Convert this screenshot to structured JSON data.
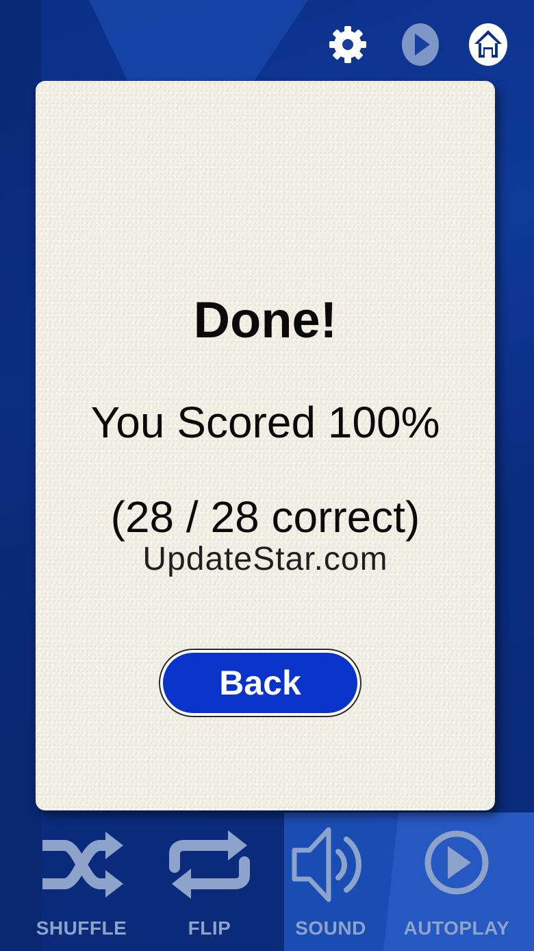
{
  "top_bar": {
    "icons": [
      "gear-icon",
      "play-circle-icon",
      "home-icon"
    ]
  },
  "result": {
    "title": "Done!",
    "score_text": "You Scored 100%",
    "count_text": "(28 / 28 correct)",
    "watermark": "UpdateStar.com",
    "back_label": "Back"
  },
  "toolbar": {
    "shuffle_label": "SHUFFLE",
    "flip_label": "FLIP",
    "sound_label": "SOUND",
    "autoplay_label": "AUTOPLAY"
  },
  "colors": {
    "background": "#0f3a9a",
    "card": "#f3f1e6",
    "button": "#0a33c9",
    "toolbar_icon": "#8ea3c9"
  }
}
